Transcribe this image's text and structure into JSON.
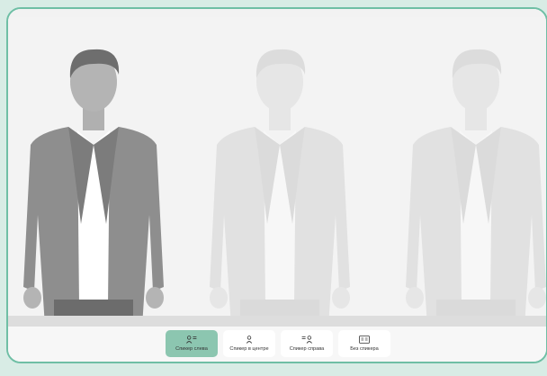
{
  "layout_options": [
    {
      "label": "Спикер слева",
      "icon": "speaker-left-icon",
      "active": true
    },
    {
      "label": "Спикер в центре",
      "icon": "speaker-center-icon",
      "active": false
    },
    {
      "label": "Спикер справа",
      "icon": "speaker-right-icon",
      "active": false
    },
    {
      "label": "Без спикера",
      "icon": "no-speaker-icon",
      "active": false
    }
  ],
  "colors": {
    "accent": "#8cc6b0",
    "frame_border": "#6fbfa5",
    "active_speaker": "#8e8e8e",
    "inactive_speaker": "#e2e2e2"
  }
}
